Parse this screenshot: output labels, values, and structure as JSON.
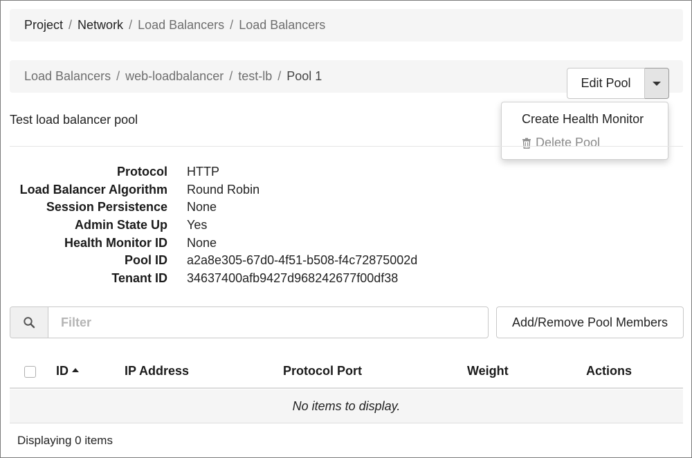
{
  "breadcrumb_top": [
    {
      "label": "Project"
    },
    {
      "label": "Network"
    },
    {
      "label": "Load Balancers"
    },
    {
      "label": "Load Balancers"
    }
  ],
  "breadcrumb_sub": [
    {
      "label": "Load Balancers"
    },
    {
      "label": "web-loadbalancer"
    },
    {
      "label": "test-lb"
    },
    {
      "label": "Pool 1"
    }
  ],
  "separator": "/",
  "actions": {
    "edit_label": "Edit Pool",
    "menu": {
      "create_health_monitor": "Create Health Monitor",
      "delete_pool": "Delete Pool"
    }
  },
  "description": "Test load balancer pool",
  "details": [
    {
      "label": "Protocol",
      "value": "HTTP"
    },
    {
      "label": "Load Balancer Algorithm",
      "value": "Round Robin"
    },
    {
      "label": "Session Persistence",
      "value": "None"
    },
    {
      "label": "Admin State Up",
      "value": "Yes"
    },
    {
      "label": "Health Monitor ID",
      "value": "None"
    },
    {
      "label": "Pool ID",
      "value": "a2a8e305-67d0-4f51-b508-f4c72875002d"
    },
    {
      "label": "Tenant ID",
      "value": "34637400afb9427d968242677f00df38"
    }
  ],
  "filter": {
    "placeholder": "Filter",
    "value": ""
  },
  "add_members_label": "Add/Remove Pool Members",
  "table": {
    "columns": [
      "ID",
      "IP Address",
      "Protocol Port",
      "Weight",
      "Actions"
    ],
    "sorted_column": "ID",
    "empty_text": "No items to display."
  },
  "footer": {
    "count_text": "Displaying 0 items"
  }
}
